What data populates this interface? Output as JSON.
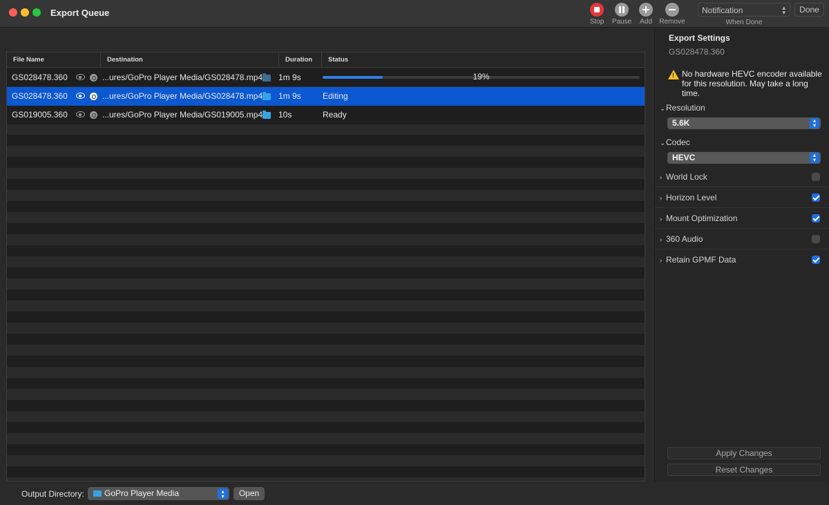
{
  "window": {
    "title": "Export Queue"
  },
  "toolbar": {
    "stop_label": "Stop",
    "pause_label": "Pause",
    "add_label": "Add",
    "remove_label": "Remove",
    "when_done_value": "Notification",
    "when_done_label": "When Done",
    "done_label": "Done"
  },
  "table": {
    "columns": [
      "File Name",
      "Destination",
      "Duration",
      "Status"
    ],
    "rows": [
      {
        "file": "GS028478.360",
        "destination": "...ures/GoPro Player Media/GS028478.mp4",
        "duration": "1m 9s",
        "status": "",
        "progress_percent": 19,
        "progress_label": "19%"
      },
      {
        "file": "GS028478.360",
        "destination": "...ures/GoPro Player Media/GS028478.mp4",
        "duration": "1m 9s",
        "status": "Editing"
      },
      {
        "file": "GS019005.360",
        "destination": "...ures/GoPro Player Media/GS019005.mp4",
        "duration": "10s",
        "status": "Ready"
      }
    ]
  },
  "bottom": {
    "output_label": "Output Directory:",
    "output_value": "GoPro Player Media",
    "open_label": "Open"
  },
  "panel": {
    "title": "Export Settings",
    "subtitle": "GS028478.360",
    "warning": "No hardware HEVC encoder available for this resolution. May take a long time.",
    "resolution_label": "Resolution",
    "resolution_value": "5.6K",
    "codec_label": "Codec",
    "codec_value": "HEVC",
    "options": [
      {
        "label": "World Lock",
        "checked": false
      },
      {
        "label": "Horizon Level",
        "checked": true
      },
      {
        "label": "Mount Optimization",
        "checked": true
      },
      {
        "label": "360 Audio",
        "checked": false
      },
      {
        "label": "Retain GPMF Data",
        "checked": true
      }
    ],
    "apply_label": "Apply Changes",
    "reset_label": "Reset Changes"
  },
  "colors": {
    "accent": "#0b58d0",
    "stop": "#e4383b",
    "warning": "#f5c026"
  }
}
